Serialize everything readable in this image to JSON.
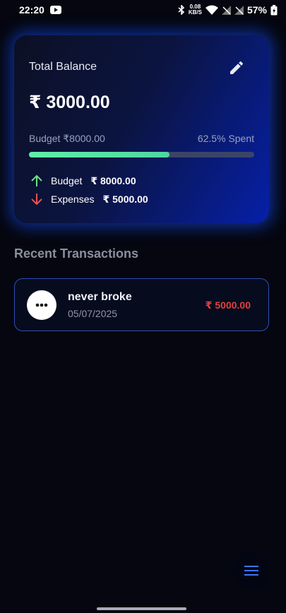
{
  "status_bar": {
    "time": "22:20",
    "net_speed_value": "0.08",
    "net_speed_unit": "KB/S",
    "battery": "57%"
  },
  "balance_card": {
    "title": "Total Balance",
    "balance": "₹ 3000.00",
    "budget_label": "Budget ₹8000.00",
    "spent_label": "62.5% Spent",
    "progress_fraction": 0.625,
    "budget_stat_label": "Budget",
    "budget_stat_value": "₹ 8000.00",
    "expenses_stat_label": "Expenses",
    "expenses_stat_value": "₹ 5000.00"
  },
  "recent": {
    "title": "Recent Transactions",
    "transactions": [
      {
        "name": "never broke",
        "date": "05/07/2025",
        "amount": "₹ 5000.00"
      }
    ]
  },
  "colors": {
    "accent_blue": "#2f4fb8",
    "income_green": "#5ff0a8",
    "expense_red": "#e0413f",
    "background": "#05060f"
  },
  "icons": {
    "edit": "pencil-icon",
    "budget": "arrow-up-icon",
    "expenses": "arrow-down-icon",
    "transaction": "more-horizontal-icon",
    "fab": "menu-icon"
  }
}
